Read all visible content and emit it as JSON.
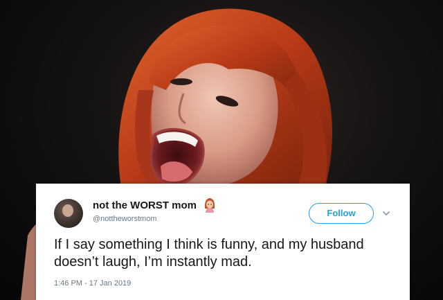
{
  "tweet": {
    "display_name": "not the WORST mom",
    "handle": "@nottheworstmom",
    "follow_label": "Follow",
    "text": "If I say something I think is funny, and my husband doesn’t laugh, I’m instantly mad.",
    "timestamp": "1:46 PM - 17 Jan 2019",
    "name_emoji_icon": "woman-emoji-icon",
    "accent_color": "#1da1f2"
  },
  "photo": {
    "subject": "woman-portrait",
    "hair_color": "#c2451e",
    "background_color": "#0b0b0b"
  }
}
